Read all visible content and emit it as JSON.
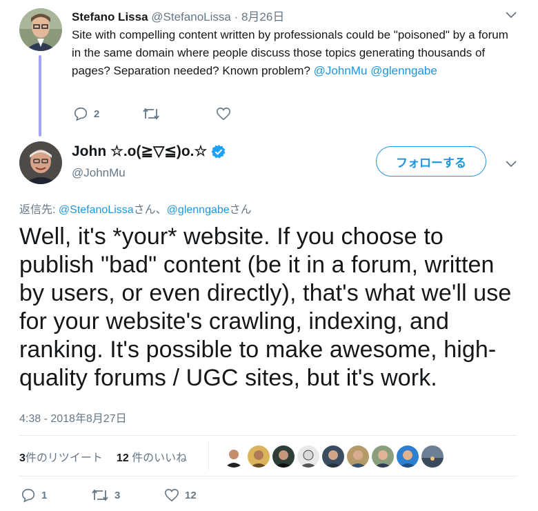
{
  "parent_tweet": {
    "name": "Stefano Lissa",
    "handle": "@StefanoLissa",
    "separator": "·",
    "date": "8月26日",
    "text_before": "Site with compelling content written by professionals could be \"poisoned\" by a forum in the same domain where people discuss those topics generating thousands of pages? Separation needed? Known problem?",
    "mention_1": "@JohnMu",
    "mention_2": "@glenngabe",
    "reply_count": "2",
    "retweet_count": "",
    "like_count": ""
  },
  "main_tweet": {
    "name": "John ☆.o(≧▽≦)o.☆",
    "handle": "@JohnMu",
    "follow_label": "フォローする",
    "reply_to_prefix": "返信先: ",
    "reply_to_1": "@StefanoLissa",
    "reply_to_sep": "さん、",
    "reply_to_2": "@glenngabe",
    "reply_to_suffix": "さん",
    "text": "Well, it's *your* website. If you choose to publish \"bad\" content (be it in a forum, written by users, or even directly), that's what we'll use for your website's crawling, indexing, and ranking. It's possible to make awesome, high-quality forums / UGC sites, but it's work.",
    "timestamp": "4:38 - 2018年8月27日",
    "retweets_num": "3",
    "retweets_label": "件のリツイート",
    "likes_num": "12",
    "likes_label": " 件のいいね",
    "reply_count": "1",
    "retweet_count": "3",
    "like_count": "12"
  },
  "colors": {
    "link": "#1b95e0",
    "thread_line": "#a4a4f7",
    "muted": "#657786",
    "verified": "#1da1f2"
  },
  "icons": [
    "chevron-down-icon",
    "reply-icon",
    "retweet-icon",
    "like-icon",
    "verified-badge-icon"
  ]
}
